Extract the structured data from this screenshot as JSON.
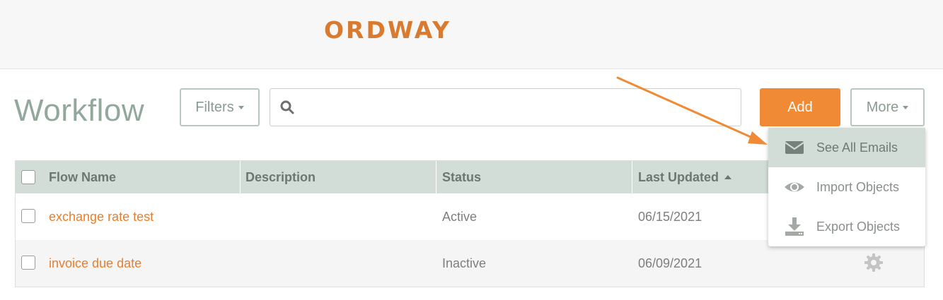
{
  "header": {
    "logo_text": "ORDWAY",
    "brand_color": "#d97a2e"
  },
  "page": {
    "title": "Workflow"
  },
  "toolbar": {
    "filters_label": "Filters",
    "search_placeholder": "",
    "add_label": "Add",
    "more_label": "More"
  },
  "table": {
    "columns": [
      "Flow Name",
      "Description",
      "Status",
      "Last Updated"
    ],
    "sort_column": "Last Updated",
    "sort_direction": "ascending",
    "rows": [
      {
        "flow_name": "exchange rate test",
        "description": "",
        "status": "Active",
        "last_updated": "06/15/2021"
      },
      {
        "flow_name": "invoice due date",
        "description": "",
        "status": "Inactive",
        "last_updated": "06/09/2021"
      }
    ]
  },
  "more_menu": {
    "items": [
      {
        "label": "See All Emails",
        "icon": "envelope-icon",
        "highlighted": true
      },
      {
        "label": "Import Objects",
        "icon": "eye-icon",
        "highlighted": false
      },
      {
        "label": "Export Objects",
        "icon": "download-icon",
        "highlighted": false
      }
    ]
  },
  "colors": {
    "accent": "#f08a34",
    "header_row": "#d3ddd7",
    "title_text": "#93a89d",
    "link_text": "#ea7d2c"
  }
}
